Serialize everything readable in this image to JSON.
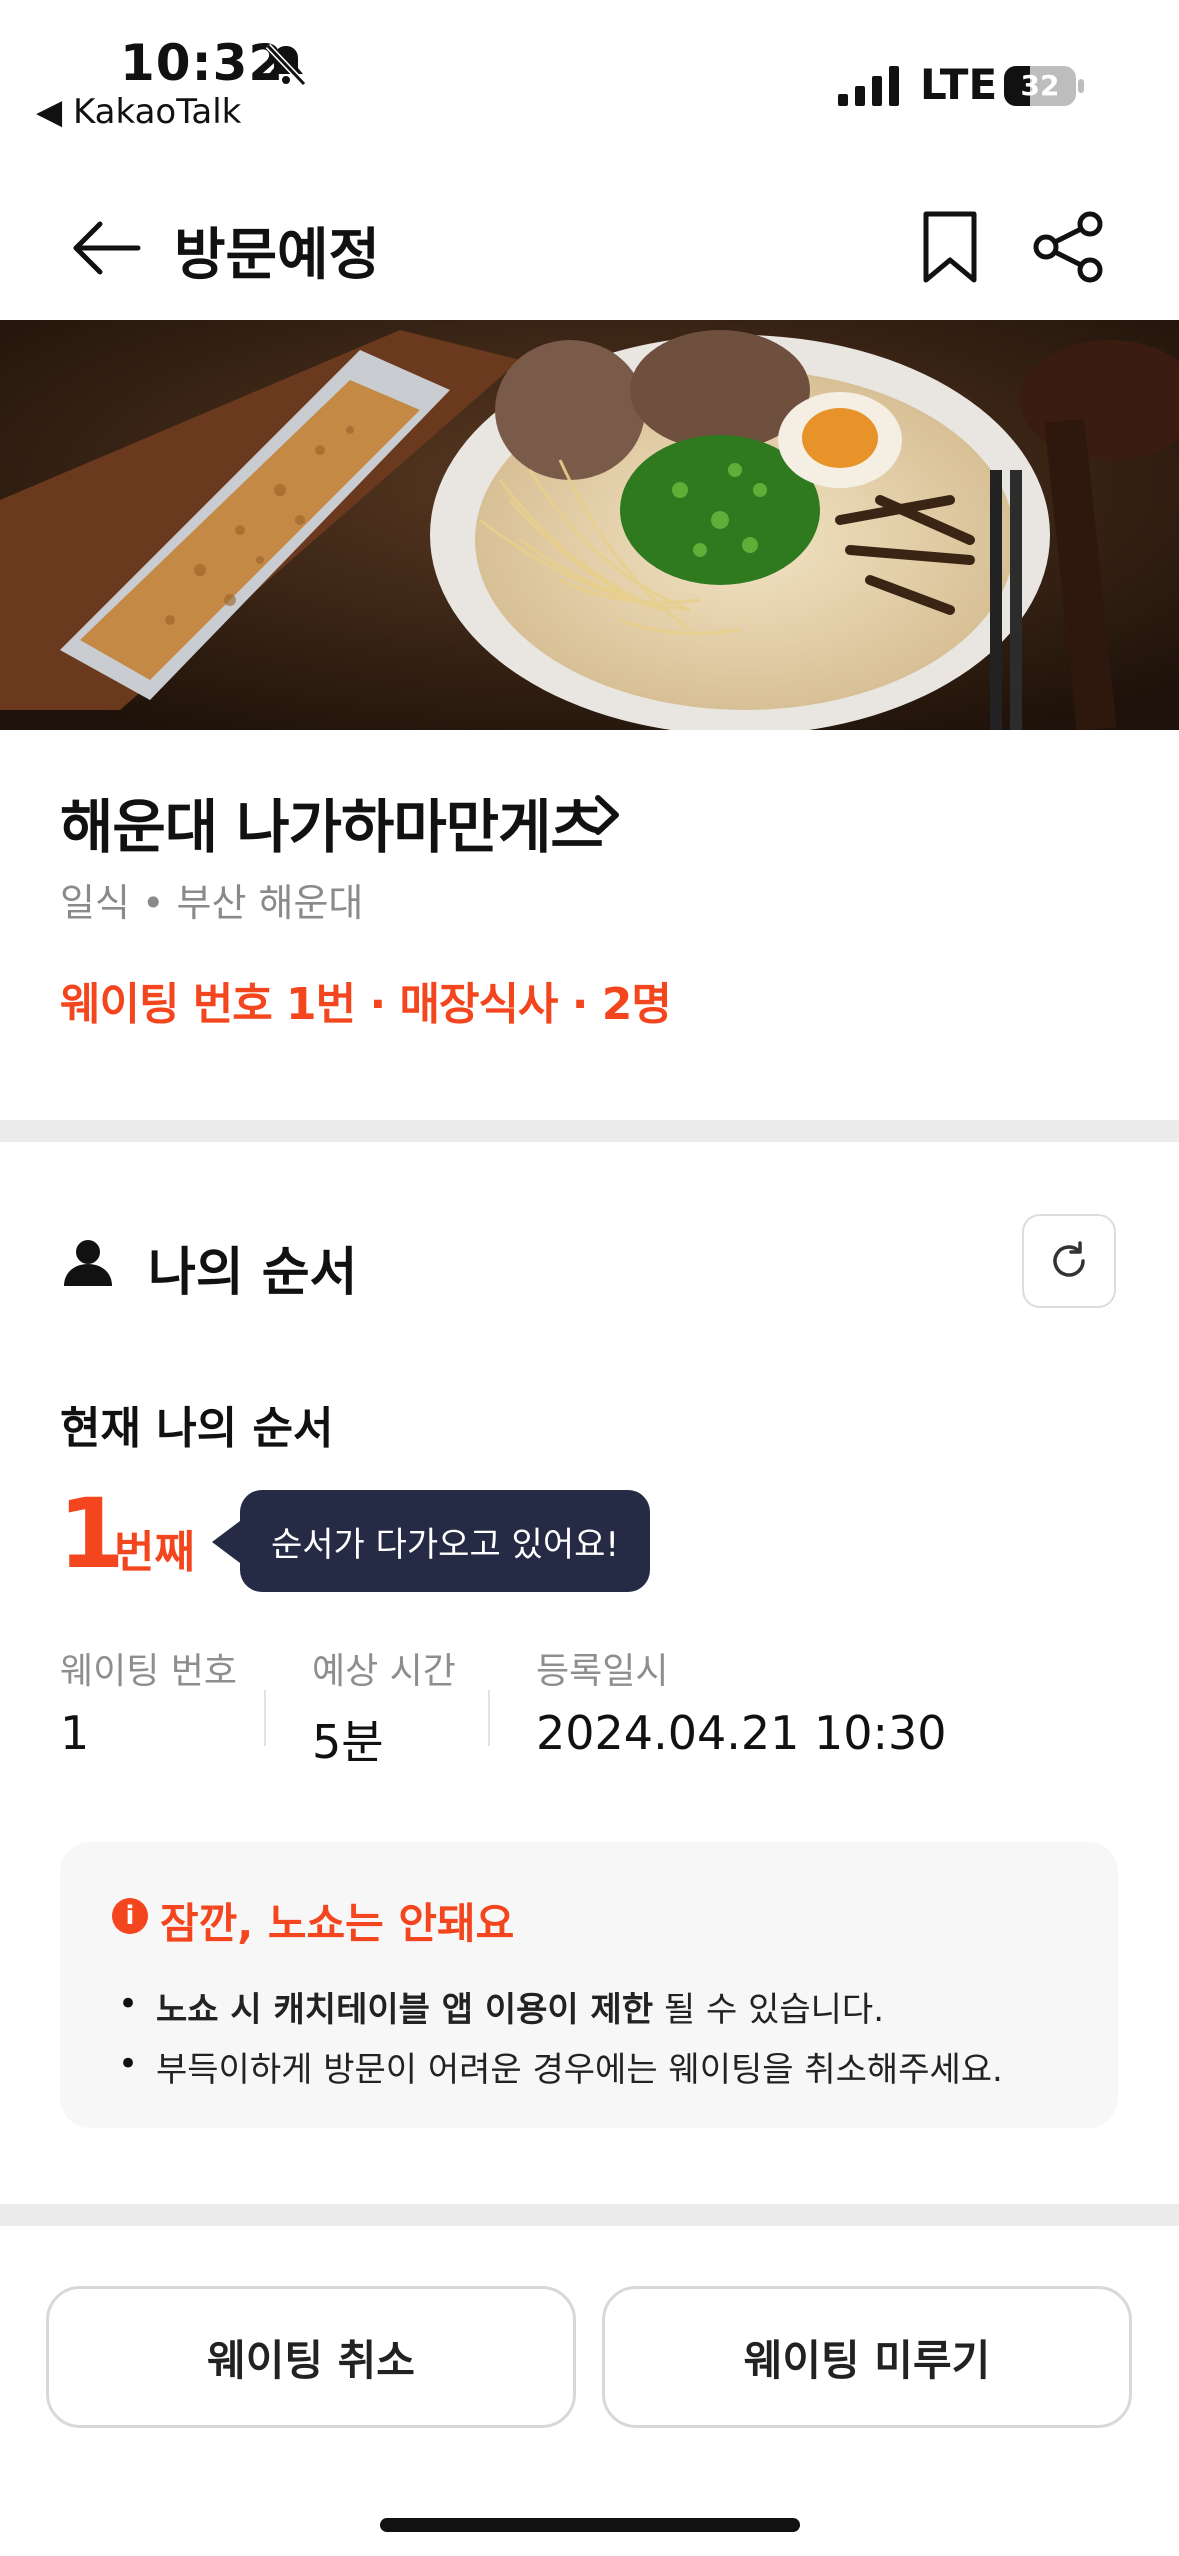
{
  "status_bar": {
    "time": "10:32",
    "back_app": "◀ KakaoTalk",
    "network": "LTE",
    "battery": "32"
  },
  "header": {
    "title": "방문예정"
  },
  "store": {
    "name": "해운대 나가하마만게츠",
    "sub": "일식 • 부산 해운대",
    "waiting_info": "웨이팅 번호 1번 · 매장식사 · 2명"
  },
  "my_order": {
    "section_title": "나의 순서",
    "current_label": "현재 나의 순서",
    "number": "1",
    "unit": "번째",
    "tooltip": "순서가 다가오고 있어요!",
    "columns": [
      {
        "label": "웨이팅 번호",
        "value": "1"
      },
      {
        "label": "예상 시간",
        "value": "5분"
      },
      {
        "label": "등록일시",
        "value": "2024.04.21 10:30"
      }
    ]
  },
  "notice": {
    "title": "잠깐, 노쇼는 안돼요",
    "line1_bold": "노쇼 시 캐치테이블 앱 이용이 제한",
    "line1_rest": " 될 수 있습니다.",
    "line2": "부득이하게 방문이 어려운 경우에는 웨이팅을 취소해주세요."
  },
  "buttons": {
    "cancel": "웨이팅 취소",
    "postpone": "웨이팅 미루기"
  },
  "colors": {
    "accent": "#f4461e",
    "tooltip_bg": "#262b45"
  }
}
